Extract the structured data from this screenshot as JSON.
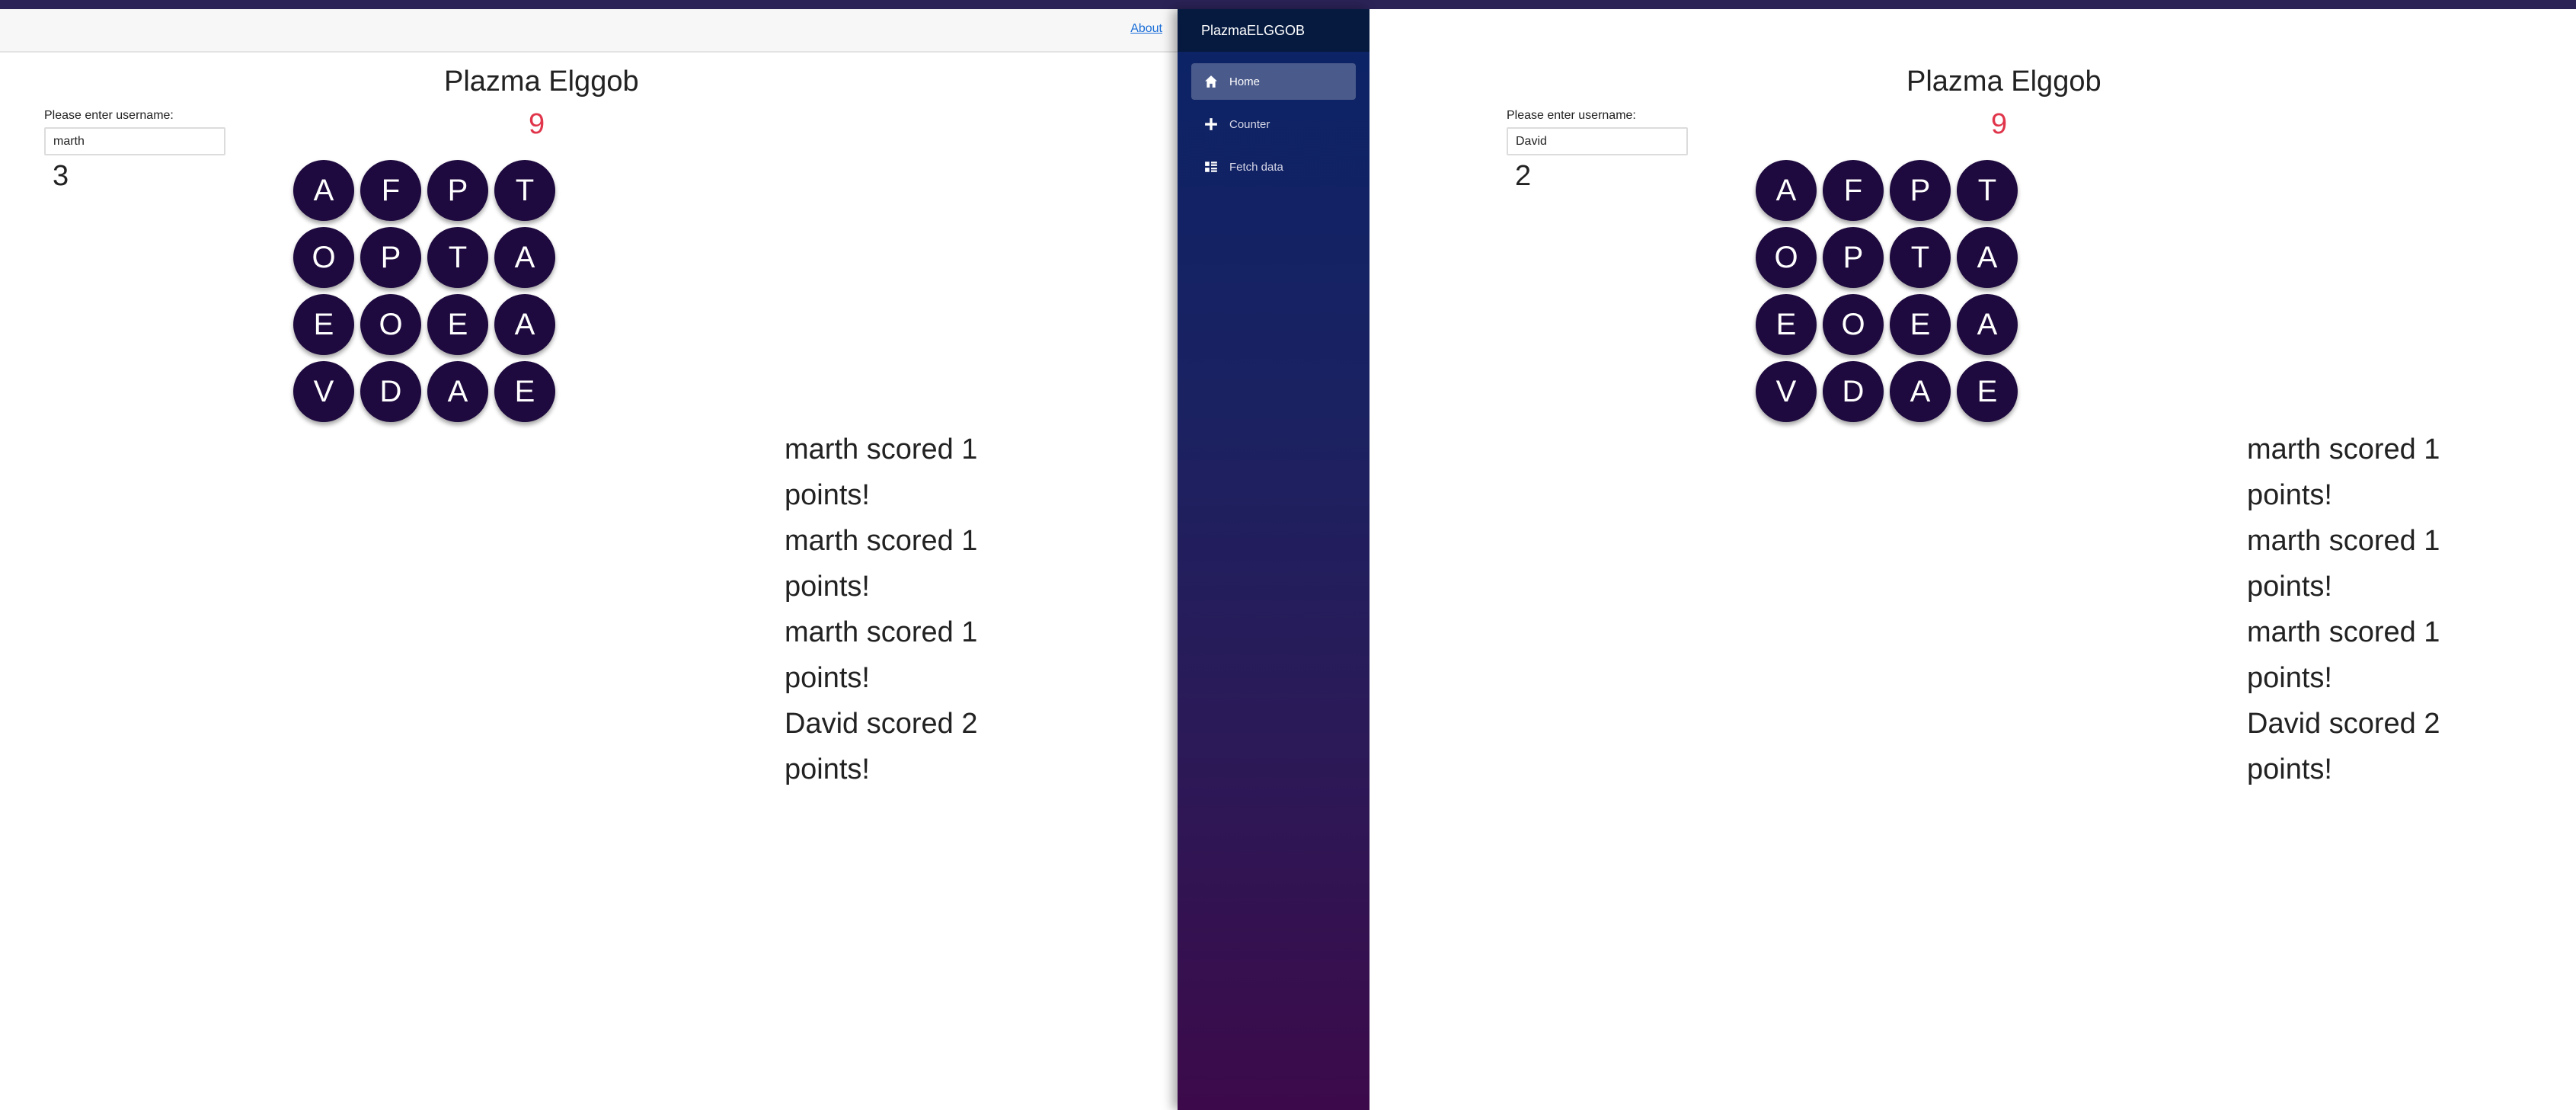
{
  "app": {
    "brand": "PlazmaELGGOB",
    "about_label": "About"
  },
  "sidebar": {
    "items": [
      {
        "label": "Home",
        "icon": "home-icon",
        "active": true
      },
      {
        "label": "Counter",
        "icon": "plus-icon",
        "active": false
      },
      {
        "label": "Fetch data",
        "icon": "list-icon",
        "active": false
      }
    ]
  },
  "left_game": {
    "title": "Plazma Elggob",
    "timer": "9",
    "username_label": "Please enter username:",
    "username_value": "marth",
    "score": "3",
    "board": [
      [
        "A",
        "F",
        "P",
        "T"
      ],
      [
        "O",
        "P",
        "T",
        "A"
      ],
      [
        "E",
        "O",
        "E",
        "A"
      ],
      [
        "V",
        "D",
        "A",
        "E"
      ]
    ],
    "messages": [
      "marth scored 1",
      "points!",
      "marth scored 1",
      "points!",
      "marth scored 1",
      "points!",
      "David scored 2",
      "points!"
    ]
  },
  "right_game": {
    "title": "Plazma Elggob",
    "timer": "9",
    "username_label": "Please enter username:",
    "username_value": "David",
    "score": "2",
    "board": [
      [
        "A",
        "F",
        "P",
        "T"
      ],
      [
        "O",
        "P",
        "T",
        "A"
      ],
      [
        "E",
        "O",
        "E",
        "A"
      ],
      [
        "V",
        "D",
        "A",
        "E"
      ]
    ],
    "messages": [
      "marth scored 1",
      "points!",
      "marth scored 1",
      "points!",
      "marth scored 1",
      "points!",
      "David scored 2",
      "points!"
    ]
  },
  "colors": {
    "tile_bg": "#1e0a3e",
    "timer": "#e0354b",
    "link": "#1a6ed8"
  }
}
